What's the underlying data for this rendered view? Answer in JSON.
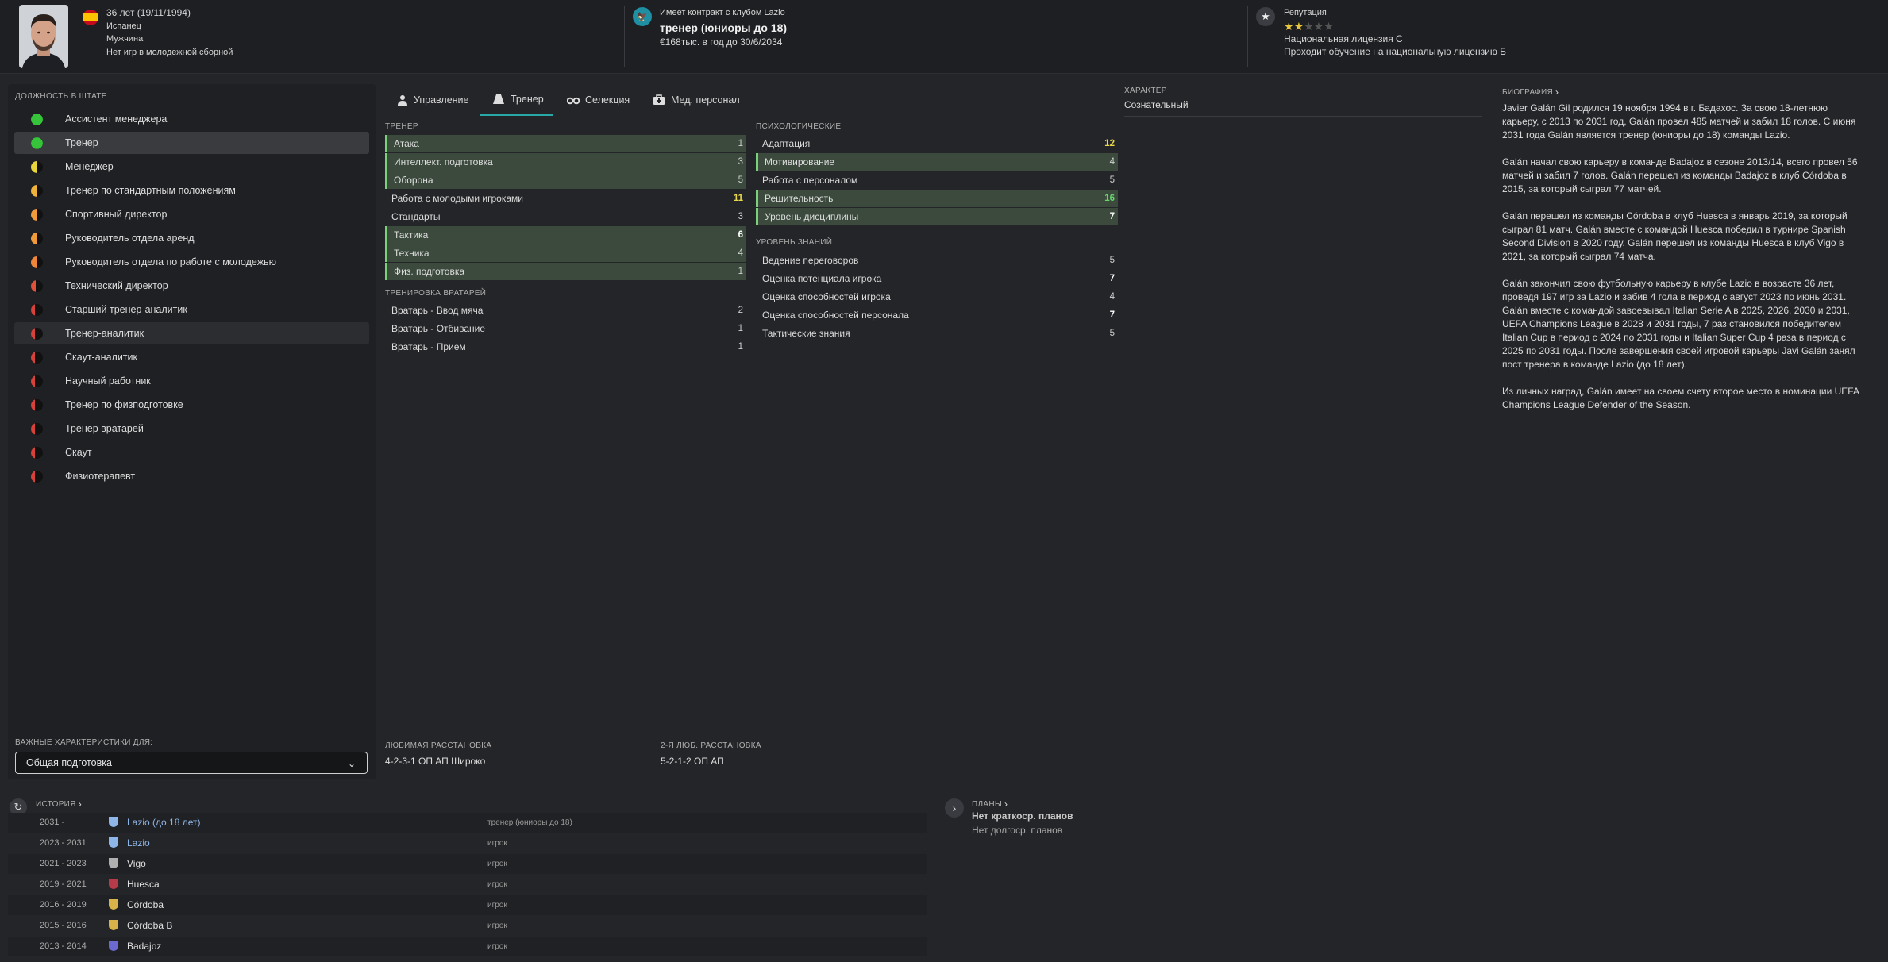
{
  "header": {
    "age_dob": "36 лет (19/11/1994)",
    "nationality": "Испанец",
    "gender": "Мужчина",
    "youth_caps": "Нет игр в молодежной сборной",
    "contract_label": "Имеет контракт с клубом Lazio",
    "job_title": "тренер (юниоры до 18)",
    "salary": "€168тыс. в год до 30/6/2034",
    "reputation_label": "Репутация",
    "reputation_stars": 1.5,
    "reputation_max": 5,
    "license": "Национальная лицензия C",
    "license_training": "Проходит обучение на национальную лицензию Б"
  },
  "staff_roles": {
    "title": "ДОЛЖНОСТЬ В ШТАТЕ",
    "items": [
      {
        "label": "Ассистент менеджера",
        "suit": 1.0,
        "color": "#35c43a"
      },
      {
        "label": "Тренер",
        "suit": 1.0,
        "color": "#35c43a"
      },
      {
        "label": "Менеджер",
        "suit": 0.5,
        "color": "#e8d53a"
      },
      {
        "label": "Тренер по стандартным положениям",
        "suit": 0.5,
        "color": "#f0b33a"
      },
      {
        "label": "Спортивный директор",
        "suit": 0.5,
        "color": "#f09a3a"
      },
      {
        "label": "Руководитель отдела аренд",
        "suit": 0.5,
        "color": "#f09a3a"
      },
      {
        "label": "Руководитель отдела по работе с молодежью",
        "suit": 0.5,
        "color": "#f0863a"
      },
      {
        "label": "Технический директор",
        "suit": 0.4,
        "color": "#e0503a"
      },
      {
        "label": "Старший тренер-аналитик",
        "suit": 0.3,
        "color": "#d8403a"
      },
      {
        "label": "Тренер-аналитик",
        "suit": 0.3,
        "color": "#d8403a"
      },
      {
        "label": "Скаут-аналитик",
        "suit": 0.3,
        "color": "#d8403a"
      },
      {
        "label": "Научный работник",
        "suit": 0.3,
        "color": "#d8403a"
      },
      {
        "label": "Тренер по физподготовке",
        "suit": 0.3,
        "color": "#d8403a"
      },
      {
        "label": "Тренер вратарей",
        "suit": 0.3,
        "color": "#d8403a"
      },
      {
        "label": "Скаут",
        "suit": 0.3,
        "color": "#d8403a"
      },
      {
        "label": "Физиотерапевт",
        "suit": 0.3,
        "color": "#d8403a"
      }
    ],
    "key_attr_label": "ВАЖНЫЕ ХАРАКТЕРИСТИКИ ДЛЯ:",
    "key_attr_value": "Общая подготовка"
  },
  "tabs": [
    {
      "label": "Управление"
    },
    {
      "label": "Тренер"
    },
    {
      "label": "Селекция"
    },
    {
      "label": "Мед. персонал"
    }
  ],
  "coach": {
    "title": "ТРЕНЕР",
    "rows": [
      {
        "name": "Атака",
        "value": "1",
        "hl": true,
        "color": ""
      },
      {
        "name": "Интеллект. подготовка",
        "value": "3",
        "hl": true,
        "color": ""
      },
      {
        "name": "Оборона",
        "value": "5",
        "hl": true,
        "color": ""
      },
      {
        "name": "Работа с молодыми игроками",
        "value": "11",
        "hl": false,
        "color": "y"
      },
      {
        "name": "Стандарты",
        "value": "3",
        "hl": false,
        "color": ""
      },
      {
        "name": "Тактика",
        "value": "6",
        "hl": true,
        "color": "w"
      },
      {
        "name": "Техника",
        "value": "4",
        "hl": true,
        "color": ""
      },
      {
        "name": "Физ. подготовка",
        "value": "1",
        "hl": true,
        "color": ""
      }
    ],
    "gk_title": "ТРЕНИРОВКА ВРАТАРЕЙ",
    "gk_rows": [
      {
        "name": "Вратарь - Ввод мяча",
        "value": "2"
      },
      {
        "name": "Вратарь - Отбивание",
        "value": "1"
      },
      {
        "name": "Вратарь - Прием",
        "value": "1"
      }
    ]
  },
  "mental": {
    "title": "ПСИХОЛОГИЧЕСКИЕ",
    "rows": [
      {
        "name": "Адаптация",
        "value": "12",
        "hl": false,
        "color": "y"
      },
      {
        "name": "Мотивирование",
        "value": "4",
        "hl": true,
        "color": ""
      },
      {
        "name": "Работа с персоналом",
        "value": "5",
        "hl": false,
        "color": ""
      },
      {
        "name": "Решительность",
        "value": "16",
        "hl": true,
        "color": "g"
      },
      {
        "name": "Уровень дисциплины",
        "value": "7",
        "hl": true,
        "color": "w"
      }
    ],
    "knowledge_title": "УРОВЕНЬ ЗНАНИЙ",
    "knowledge_rows": [
      {
        "name": "Ведение переговоров",
        "value": "5",
        "color": ""
      },
      {
        "name": "Оценка потенциала игрока",
        "value": "7",
        "color": "w"
      },
      {
        "name": "Оценка способностей игрока",
        "value": "4",
        "color": ""
      },
      {
        "name": "Оценка способностей персонала",
        "value": "7",
        "color": "w"
      },
      {
        "name": "Тактические знания",
        "value": "5",
        "color": ""
      }
    ]
  },
  "character": {
    "title": "ХАРАКТЕР",
    "value": "Сознательный"
  },
  "formations": {
    "fav_label": "ЛЮБИМАЯ РАССТАНОВКА",
    "fav_value": "4-2-3-1 ОП АП Широко",
    "second_label": "2-Я ЛЮБ. РАССТАНОВКА",
    "second_value": "5-2-1-2 ОП АП"
  },
  "biography": {
    "title": "БИОГРАФИЯ",
    "paragraphs": [
      "Javier Galán Gil родился 19 ноября 1994 в г. Бадахос. За свою 18-летнюю карьеру, с 2013 по 2031 год, Galán провел 485 матчей и забил 18 голов. С июня 2031 года Galán является тренер (юниоры до 18) команды Lazio.",
      "Galán начал свою карьеру в команде Badajoz в сезоне 2013/14, всего провел 56 матчей и забил 7 голов. Galán перешел из команды Badajoz в клуб Córdoba в 2015, за который сыграл 77 матчей.",
      "Galán перешел из команды Córdoba в клуб Huesca в январь 2019, за который сыграл 81 матч. Galán вместе с командой Huesca победил в турнире Spanish Second Division в 2020 году. Galán перешел из команды Huesca в клуб Vigo в 2021, за который сыграл 74 матча.",
      "Galán закончил свою футбольную карьеру в клубе Lazio в возрасте 36 лет, проведя 197 игр за Lazio и забив 4 гола в период с август 2023 по июнь 2031. Galán вместе с командой завоевывал Italian Serie A в 2025, 2026, 2030 и 2031, UEFA Champions League в 2028 и 2031 годы, 7 раз становился победителем Italian Cup в период с 2024 по 2031 годы и Italian Super Cup 4 раза в период с 2025 по 2031 годы. После завершения своей игровой карьеры Javi Galán занял пост тренера в команде Lazio (до 18 лет).",
      "Из личных наград, Galán имеет на своем счету второе место в номинации UEFA Champions League Defender of the Season."
    ]
  },
  "history": {
    "title": "ИСТОРИЯ",
    "rows": [
      {
        "years": "2031 -",
        "club": "Lazio (до 18 лет)",
        "role": "тренер (юниоры до 18)",
        "link": true
      },
      {
        "years": "2023 - 2031",
        "club": "Lazio",
        "role": "игрок",
        "link": true
      },
      {
        "years": "2021 - 2023",
        "club": "Vigo",
        "role": "игрок",
        "link": false
      },
      {
        "years": "2019 - 2021",
        "club": "Huesca",
        "role": "игрок",
        "link": false
      },
      {
        "years": "2016 - 2019",
        "club": "Córdoba",
        "role": "игрок",
        "link": false
      },
      {
        "years": "2015 - 2016",
        "club": "Córdoba B",
        "role": "игрок",
        "link": false
      },
      {
        "years": "2013 - 2014",
        "club": "Badajoz",
        "role": "игрок",
        "link": false
      }
    ]
  },
  "plans": {
    "title": "ПЛАНЫ",
    "short": "Нет краткоср. планов",
    "long": "Нет долгоср. планов"
  }
}
